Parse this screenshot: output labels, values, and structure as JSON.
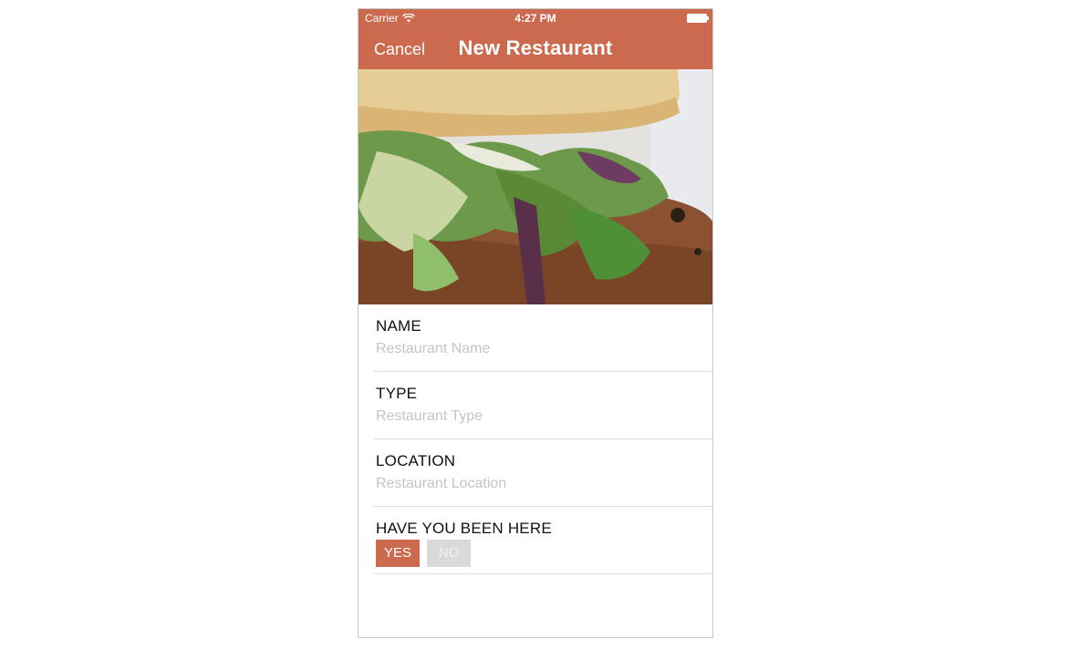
{
  "status_bar": {
    "carrier": "Carrier",
    "time": "4:27 PM"
  },
  "nav": {
    "cancel_label": "Cancel",
    "title": "New Restaurant"
  },
  "colors": {
    "accent": "#cc6a4f",
    "placeholder": "#c5c5c5",
    "inactive_choice": "#dadada"
  },
  "form": {
    "name": {
      "label": "NAME",
      "placeholder": "Restaurant Name",
      "value": ""
    },
    "type": {
      "label": "TYPE",
      "placeholder": "Restaurant Type",
      "value": ""
    },
    "location": {
      "label": "LOCATION",
      "placeholder": "Restaurant Location",
      "value": ""
    },
    "been_here": {
      "label": "HAVE YOU BEEN HERE",
      "yes_label": "YES",
      "no_label": "NO",
      "selected": "YES"
    }
  }
}
